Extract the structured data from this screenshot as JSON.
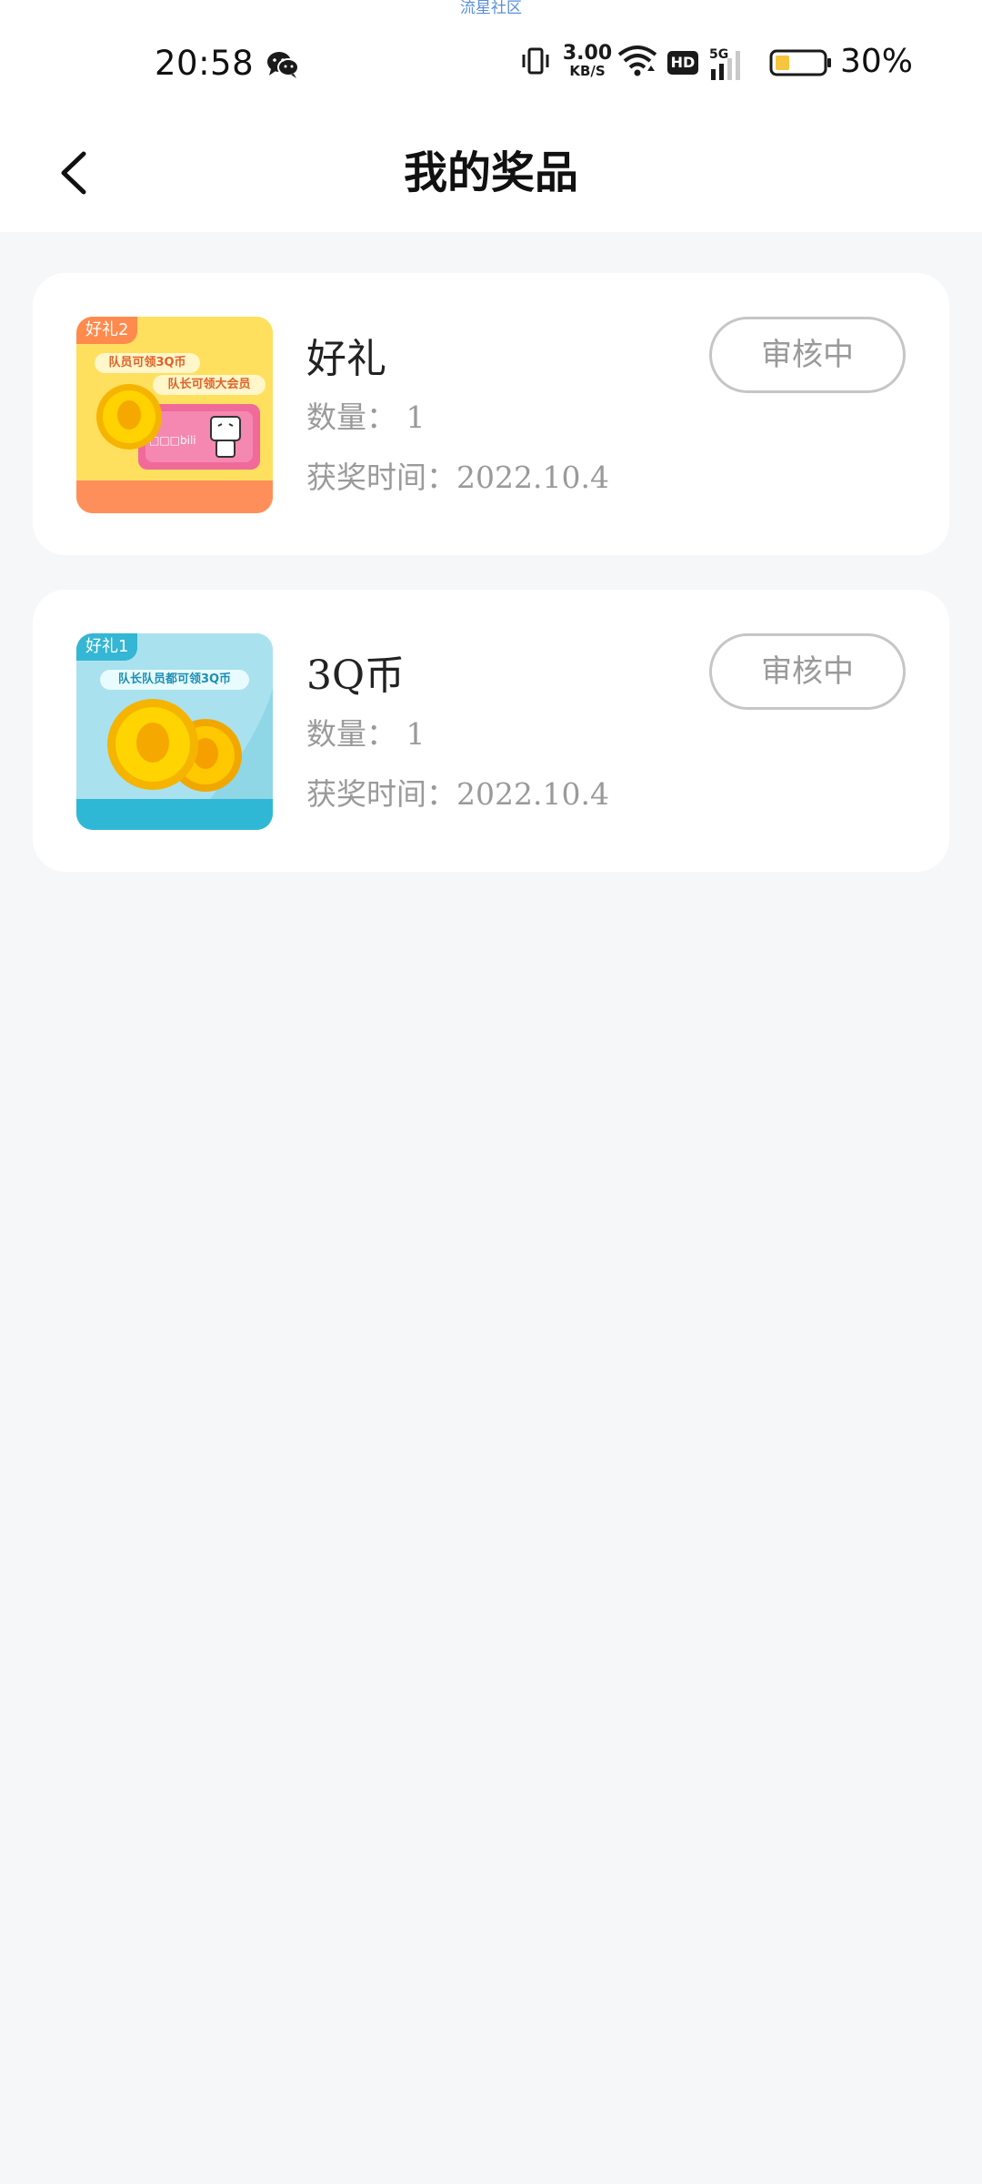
{
  "status_bar": {
    "banner": "流星社区",
    "time": "20:58",
    "net_speed_value": "3.00",
    "net_speed_unit": "KB/S",
    "hd_label": "HD",
    "signal_label": "5G",
    "battery_percent": "30%",
    "battery_level": 0.3,
    "icons": [
      "wechat-icon",
      "vibrate-icon",
      "wifi-icon",
      "signal-icon",
      "battery-icon"
    ]
  },
  "header": {
    "title": "我的奖品",
    "back_icon": "chevron-left-icon"
  },
  "prizes": [
    {
      "tag": "好礼2",
      "bubble_1": "队员可领3Q币",
      "bubble_2": "队长可领大会员",
      "name": "好礼",
      "quantity": "数量： 1",
      "time": "获奖时间：2022.10.4",
      "status": "审核中",
      "theme": "#ffd84d"
    },
    {
      "tag": "好礼1",
      "bubble_1": "队长队员都可领3Q币",
      "name": "3Q币",
      "quantity": "数量： 1",
      "time": "获奖时间：2022.10.4",
      "status": "审核中",
      "theme": "#a8e3ef"
    }
  ]
}
